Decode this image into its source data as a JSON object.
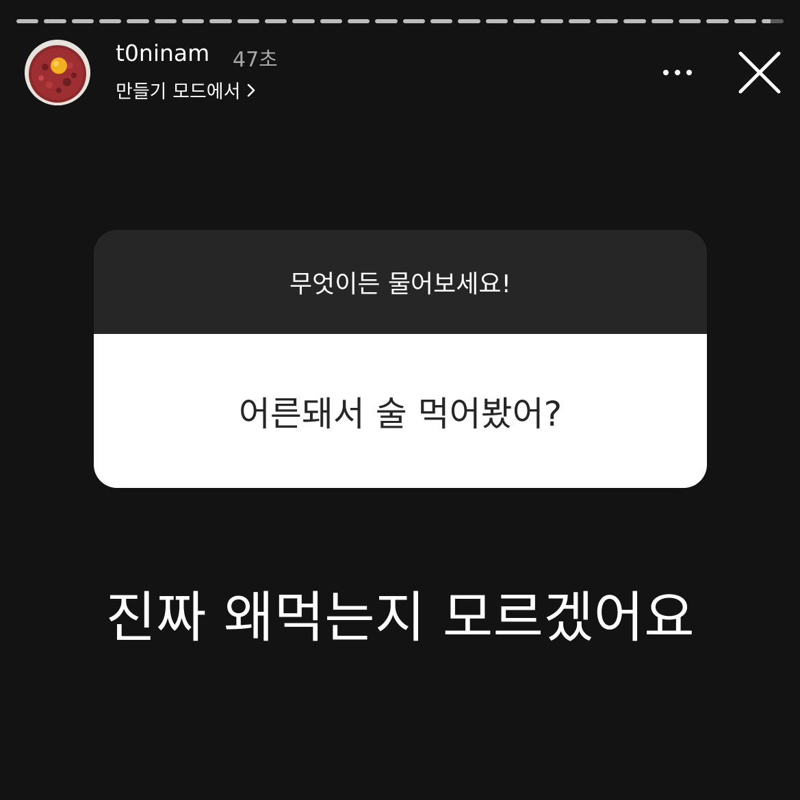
{
  "header": {
    "username": "t0ninam",
    "timestamp": "47초",
    "subtitle": "만들기 모드에서",
    "avatar_icon": "food-photo-avatar"
  },
  "progress": {
    "segments": 28,
    "current_segment": 28,
    "current_segment_fraction": 0.4
  },
  "controls": {
    "more_icon": "more-dots-icon",
    "close_icon": "close-icon",
    "chevron_icon": "chevron-right-icon"
  },
  "question_sticker": {
    "prompt": "무엇이든 물어보세요!",
    "question": "어른돼서 술 먹어봤어?"
  },
  "reply": {
    "text": "진짜 왜먹는지 모르겠어요"
  },
  "colors": {
    "background": "#131313",
    "sticker_header": "#262626",
    "sticker_body": "#ffffff",
    "progress_filled": "#bcbcbc"
  }
}
